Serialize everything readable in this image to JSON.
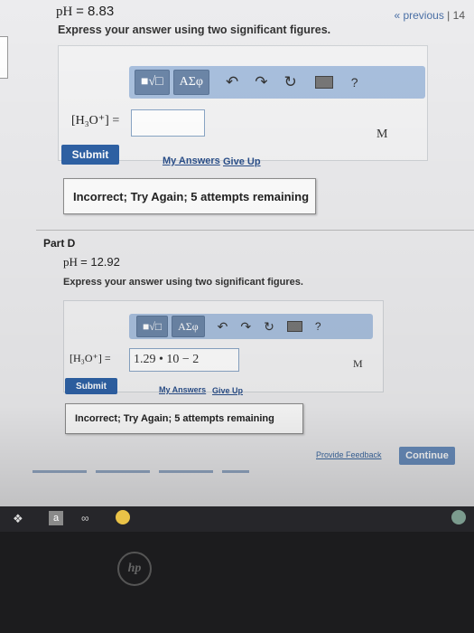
{
  "pager": {
    "previous": "« previous",
    "sep": "|",
    "page": "14"
  },
  "partC": {
    "ph_label": "pH",
    "ph_value": "= 8.83",
    "instruction": "Express your answer using two significant figures.",
    "toolbar": {
      "matrix_btn": "■√□",
      "greek_btn": "ΑΣφ",
      "help": "?"
    },
    "var_label": "[H₃O⁺] =",
    "input_value": "",
    "unit": "M",
    "submit": "Submit",
    "my_answers": "My Answers",
    "give_up": "Give Up",
    "feedback": "Incorrect; Try Again; 5 attempts remaining"
  },
  "partD": {
    "label": "Part D",
    "ph_label": "pH",
    "ph_value": "= 12.92",
    "instruction": "Express your answer using two significant figures.",
    "toolbar": {
      "matrix_btn": "■√□",
      "greek_btn": "ΑΣφ",
      "help": "?"
    },
    "var_label": "[H₃O⁺] =",
    "input_value": "1.29 • 10 − 2",
    "unit": "M",
    "submit": "Submit",
    "my_answers": "My Answers",
    "give_up": "Give Up",
    "feedback": "Incorrect; Try Again; 5 attempts remaining"
  },
  "footer": {
    "provide_feedback": "Provide Feedback",
    "continue": "Continue"
  },
  "taskbar": {
    "a_label": "a"
  },
  "laptop": {
    "logo": "hp"
  }
}
